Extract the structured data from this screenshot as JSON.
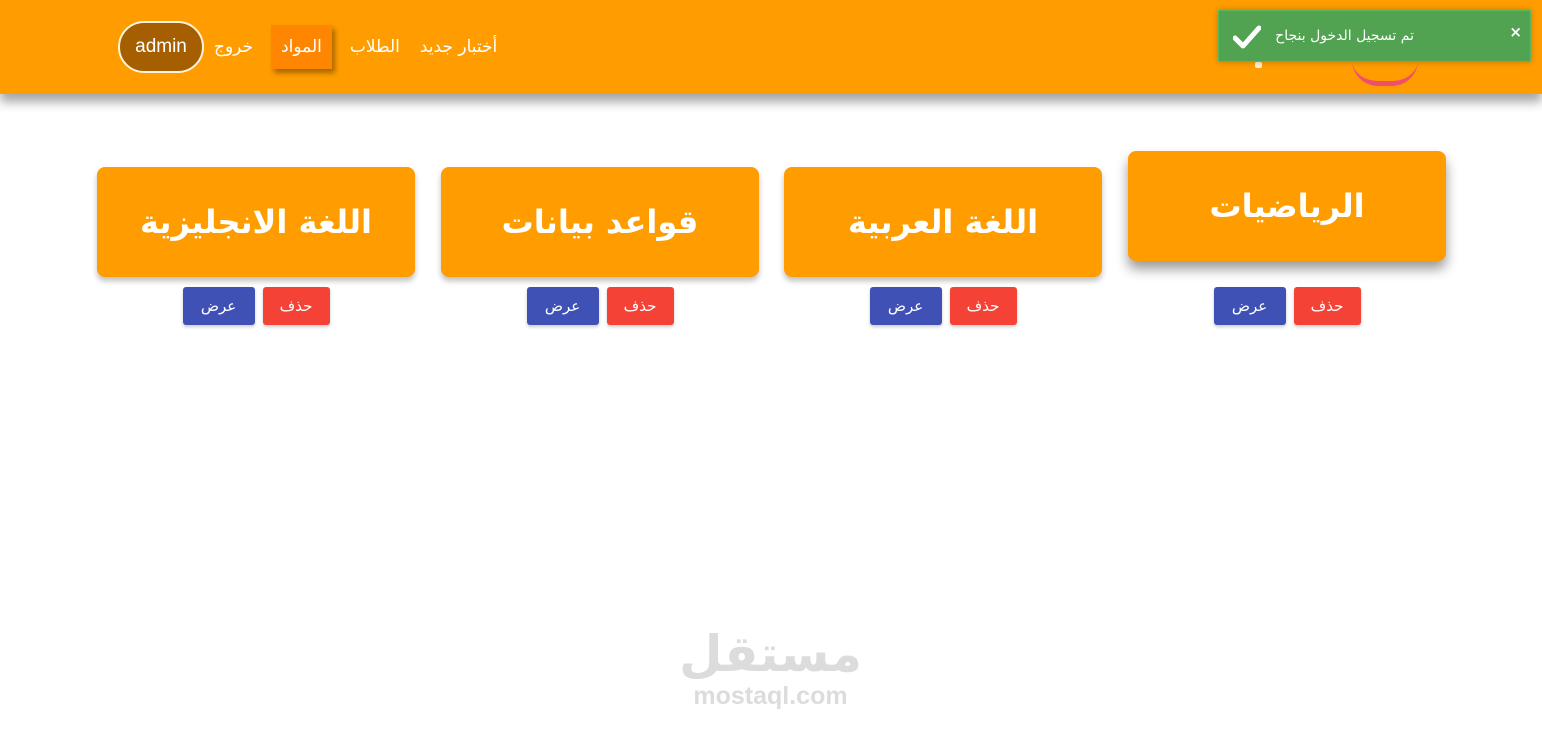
{
  "header": {
    "nav": {
      "user_label": "admin",
      "logout": "خروج",
      "subjects": "المواد",
      "students": "الطلاب",
      "new_exam": "أختبار جديد"
    }
  },
  "toast": {
    "message": "تم تسجيل الدخول بنجاح",
    "close": "×",
    "icon": "check-icon"
  },
  "subjects": [
    {
      "title": "اللغة الانجليزية",
      "show_label": "عرض",
      "delete_label": "حذف"
    },
    {
      "title": "قواعد بيانات",
      "show_label": "عرض",
      "delete_label": "حذف"
    },
    {
      "title": "اللغة العربية",
      "show_label": "عرض",
      "delete_label": "حذف"
    },
    {
      "title": "الرياضيات",
      "show_label": "عرض",
      "delete_label": "حذف"
    }
  ],
  "watermark": {
    "arabic": "مستقل",
    "latin": "mostaql.com"
  },
  "colors": {
    "header_bg": "#ff9d00",
    "toast_bg": "#51a351",
    "show_button": "#3f51b5",
    "delete_button": "#f44336"
  }
}
